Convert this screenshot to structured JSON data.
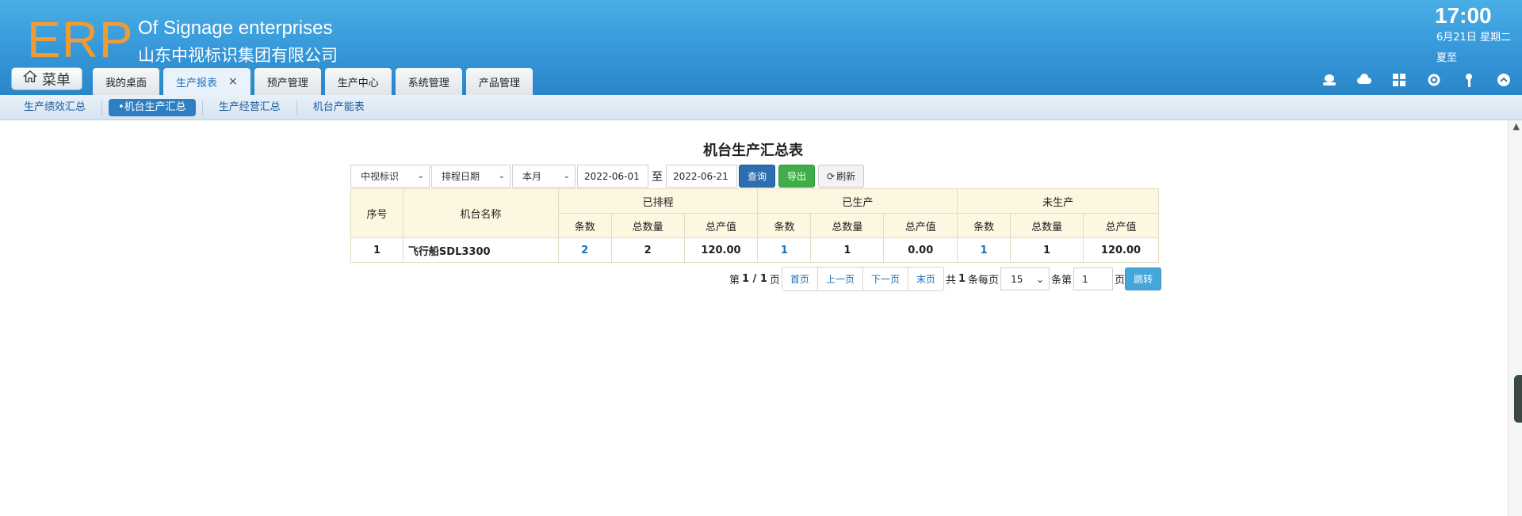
{
  "header": {
    "logo": "ERP",
    "brand_en": "Of Signage enterprises",
    "brand_cn": "山东中视标识集团有限公司",
    "clock_time": "17:00",
    "clock_date": "6月21日 星期二",
    "clock_term": "夏至",
    "menu_label": "菜单",
    "accent_color": "#f29b35",
    "tabs": [
      {
        "label": "我的桌面"
      },
      {
        "label": "生产报表",
        "active": true,
        "close": "×"
      },
      {
        "label": "预产管理"
      },
      {
        "label": "生产中心"
      },
      {
        "label": "系统管理"
      },
      {
        "label": "产品管理"
      }
    ],
    "icons": [
      "user-icon",
      "cloud-icon",
      "apps-icon",
      "gear-icon",
      "key-icon",
      "collapse-icon"
    ]
  },
  "subnav": {
    "items": [
      {
        "label": "生产绩效汇总"
      },
      {
        "label": "•机台生产汇总",
        "active": true
      },
      {
        "label": "生产经营汇总"
      },
      {
        "label": "机台产能表"
      }
    ]
  },
  "report": {
    "title": "机台生产汇总表",
    "filters": {
      "company": "中视标识",
      "date_type": "排程日期",
      "period": "本月",
      "date_from": "2022-06-01",
      "to_label": "至",
      "date_to": "2022-06-21",
      "query_label": "查询",
      "export_label": "导出",
      "refresh_label": "刷新"
    },
    "table": {
      "headers": {
        "seq": "序号",
        "machine": "机台名称",
        "scheduled": "已排程",
        "produced": "已生产",
        "unproduced": "未生产",
        "count": "条数",
        "qty": "总数量",
        "value": "总产值"
      },
      "rows": [
        {
          "seq": "1",
          "machine": "飞行船SDL3300",
          "s_count": "2",
          "s_qty": "2",
          "s_value": "120.00",
          "p_count": "1",
          "p_qty": "1",
          "p_value": "0.00",
          "u_count": "1",
          "u_qty": "1",
          "u_value": "120.00"
        }
      ]
    },
    "pager": {
      "page_prefix": "第",
      "page_current": "1 / 1",
      "page_suffix": "页",
      "first": "首页",
      "prev": "上一页",
      "next": "下一页",
      "last": "末页",
      "total_prefix": "共",
      "total": "1",
      "total_suffix": "条每页",
      "page_size": "15",
      "size_suffix": "条第",
      "goto_page": "1",
      "goto_suffix": "页",
      "go": "跳转"
    }
  }
}
